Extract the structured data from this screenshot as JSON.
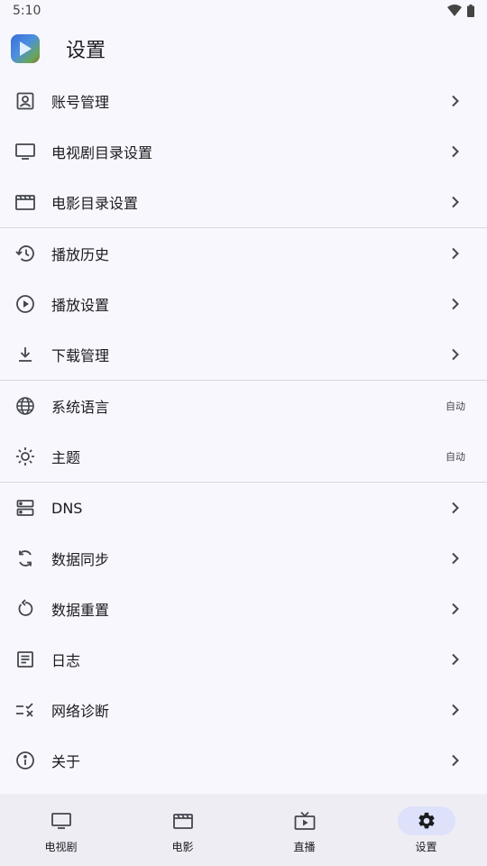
{
  "status_bar": {
    "time": "5:10"
  },
  "app_bar": {
    "title": "设置"
  },
  "settings": {
    "group1": [
      {
        "label": "账号管理",
        "icon": "account-box-icon"
      },
      {
        "label": "电视剧目录设置",
        "icon": "tv-icon"
      },
      {
        "label": "电影目录设置",
        "icon": "movie-icon"
      }
    ],
    "group2": [
      {
        "label": "播放历史",
        "icon": "history-icon"
      },
      {
        "label": "播放设置",
        "icon": "play-circle-icon"
      },
      {
        "label": "下载管理",
        "icon": "download-icon"
      }
    ],
    "group3": [
      {
        "label": "系统语言",
        "icon": "globe-icon",
        "value": "自动"
      },
      {
        "label": "主题",
        "icon": "brightness-icon",
        "value": "自动"
      }
    ],
    "group4": [
      {
        "label": "DNS",
        "icon": "dns-icon"
      },
      {
        "label": "数据同步",
        "icon": "sync-icon"
      },
      {
        "label": "数据重置",
        "icon": "reset-icon"
      },
      {
        "label": "日志",
        "icon": "log-icon"
      },
      {
        "label": "网络诊断",
        "icon": "diagnosis-icon"
      },
      {
        "label": "关于",
        "icon": "info-icon"
      }
    ]
  },
  "bottom_nav": [
    {
      "label": "电视剧",
      "icon": "tv-icon"
    },
    {
      "label": "电影",
      "icon": "movie-icon"
    },
    {
      "label": "直播",
      "icon": "live-tv-icon"
    },
    {
      "label": "设置",
      "icon": "gear-icon",
      "active": true
    }
  ]
}
